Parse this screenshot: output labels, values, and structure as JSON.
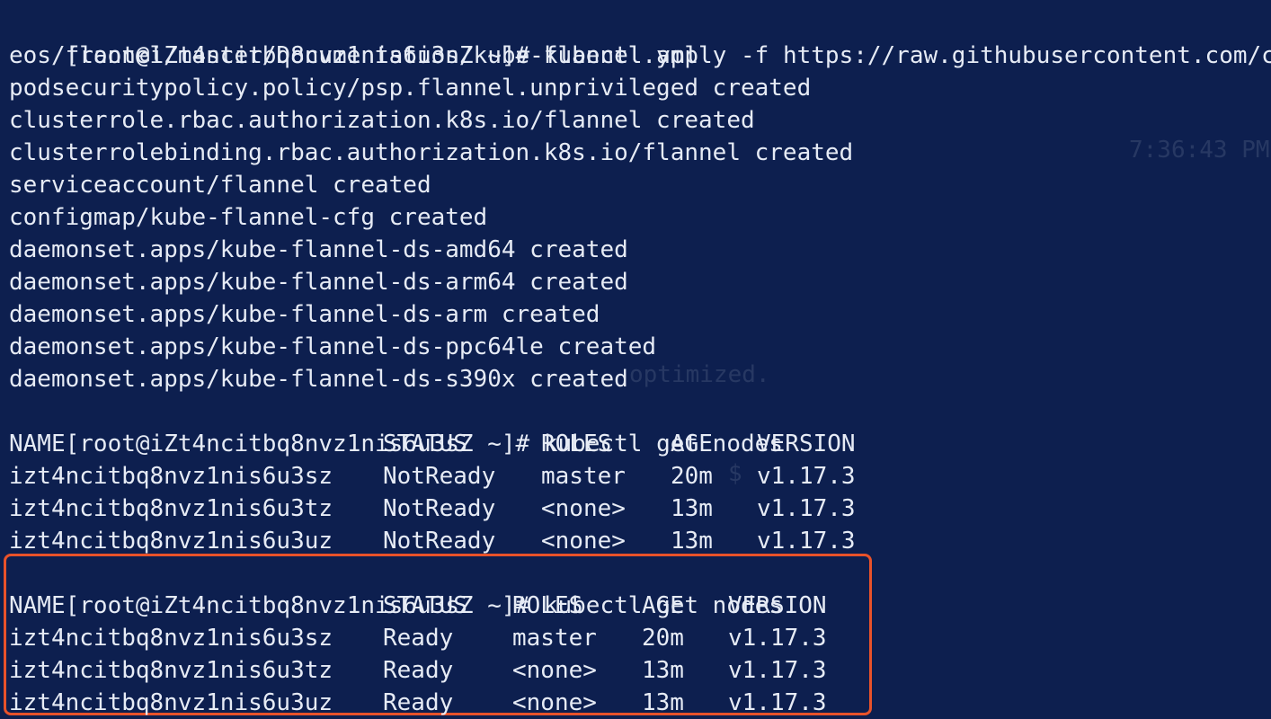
{
  "terminal": {
    "background_color": "#0d1f4f",
    "text_color": "#e6ebf5",
    "highlight_color": "#e8522a",
    "apply_command": {
      "prompt": "[root@iZt4ncitbq8nvz1nis6u3sZ ~]#",
      "command": "kubectl apply -f https://raw.githubusercontent.com/cor",
      "continuation": "eos/flannel/master/Documentation/kube-flannel.yml"
    },
    "apply_output": [
      "podsecuritypolicy.policy/psp.flannel.unprivileged created",
      "clusterrole.rbac.authorization.k8s.io/flannel created",
      "clusterrolebinding.rbac.authorization.k8s.io/flannel created",
      "serviceaccount/flannel created",
      "configmap/kube-flannel-cfg created",
      "daemonset.apps/kube-flannel-ds-amd64 created",
      "daemonset.apps/kube-flannel-ds-arm64 created",
      "daemonset.apps/kube-flannel-ds-arm created",
      "daemonset.apps/kube-flannel-ds-ppc64le created",
      "daemonset.apps/kube-flannel-ds-s390x created"
    ],
    "get_nodes_first": {
      "prompt": "[root@iZt4ncitbq8nvz1nis6u3sZ ~]#",
      "command": "kubectl get nodes",
      "headers": [
        "NAME",
        "STATUS",
        "ROLES",
        "AGE",
        "VERSION"
      ],
      "rows": [
        [
          "izt4ncitbq8nvz1nis6u3sz",
          "NotReady",
          "master",
          "20m",
          "v1.17.3"
        ],
        [
          "izt4ncitbq8nvz1nis6u3tz",
          "NotReady",
          "<none>",
          "13m",
          "v1.17.3"
        ],
        [
          "izt4ncitbq8nvz1nis6u3uz",
          "NotReady",
          "<none>",
          "13m",
          "v1.17.3"
        ]
      ]
    },
    "get_nodes_second": {
      "prompt": "[root@iZt4ncitbq8nvz1nis6u3sZ ~]#",
      "command": "kubectl get nodes",
      "headers": [
        "NAME",
        "STATUS",
        "ROLES",
        "AGE",
        "VERSION"
      ],
      "rows": [
        [
          "izt4ncitbq8nvz1nis6u3sz",
          "Ready",
          "master",
          "20m",
          "v1.17.3"
        ],
        [
          "izt4ncitbq8nvz1nis6u3tz",
          "Ready",
          "<none>",
          "13m",
          "v1.17.3"
        ],
        [
          "izt4ncitbq8nvz1nis6u3uz",
          "Ready",
          "<none>",
          "13m",
          "v1.17.3"
        ]
      ]
    },
    "background_ghost_text": [
      "7:36:43 PM",
      "optimized.",
      "$"
    ]
  }
}
